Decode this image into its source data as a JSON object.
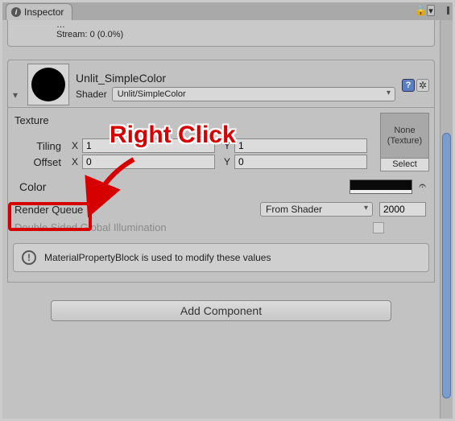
{
  "tab_title": "Inspector",
  "truncated_stream_line": "Stream: 0 (0.0%)",
  "material": {
    "name": "Unlit_SimpleColor",
    "shader_label": "Shader",
    "shader_value": "Unlit/SimpleColor"
  },
  "texture": {
    "label": "Texture",
    "tiling_label": "Tiling",
    "offset_label": "Offset",
    "x_label": "X",
    "y_label": "Y",
    "tiling_x": "1",
    "tiling_y": "1",
    "offset_x": "0",
    "offset_y": "0",
    "slot_line1": "None",
    "slot_line2": "(Texture)",
    "select_label": "Select"
  },
  "color": {
    "label": "Color",
    "value_hex": "#000000"
  },
  "render_queue": {
    "label": "Render Queue",
    "mode": "From Shader",
    "value": "2000"
  },
  "dgi_label": "Double Sided Global Illumination",
  "info_message": "MaterialPropertyBlock is used to modify these values",
  "add_component_label": "Add Component",
  "annotation_text": "Right Click"
}
